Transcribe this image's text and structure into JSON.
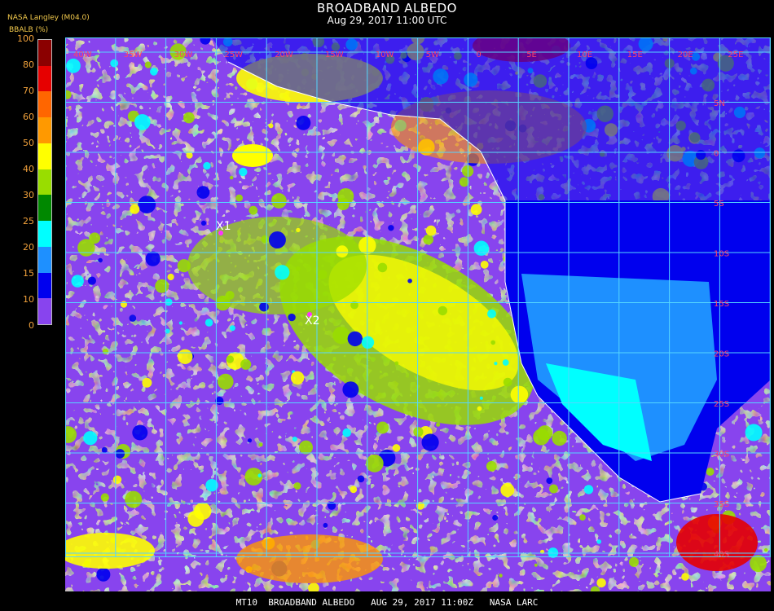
{
  "header": {
    "title": "BROADBAND ALBEDO",
    "subtitle": "Aug 29, 2017 11:00 UTC",
    "producer": "NASA Langley (M04.0)"
  },
  "legend": {
    "label": "BBALB (%)",
    "ticks": [
      "100",
      "80",
      "70",
      "60",
      "50",
      "40",
      "30",
      "25",
      "20",
      "15",
      "10",
      "0"
    ],
    "colors": [
      "#8b0000",
      "#e60000",
      "#ff6600",
      "#ff9900",
      "#ffff00",
      "#99dd00",
      "#008800",
      "#00ffff",
      "#1e90ff",
      "#0000ee",
      "#8844ee"
    ]
  },
  "map": {
    "grid_color": "#55d6ff",
    "top_lon_labels": [
      "40W",
      "35W",
      "30W",
      "25W",
      "20W",
      "15W",
      "10W",
      "5W",
      "0",
      "5E",
      "10E",
      "15E",
      "20E",
      "25E",
      "30E",
      "35E"
    ],
    "right_lat_labels": [
      "5N",
      "0",
      "5S",
      "10S",
      "15S",
      "20S",
      "25S",
      "30S",
      "35S",
      "40S"
    ],
    "markers": [
      {
        "label": "X1",
        "color": "#ff33ff"
      },
      {
        "label": "X2",
        "color": "#ff33ff"
      }
    ],
    "colors": {
      "ocean_clear": "#8844ee",
      "land_clear": "#0000ee",
      "desert": "#1e90ff",
      "bright_desert": "#00ffff",
      "low_cloud": "#99dd00",
      "mid_cloud": "#ffff00",
      "thick_cloud": "#ff9900",
      "deep_cloud": "#e60000",
      "coast": "#ffffff"
    }
  },
  "footer": {
    "text": "MT10  BROADBAND ALBEDO   AUG 29, 2017 11:00Z   NASA LARC"
  }
}
